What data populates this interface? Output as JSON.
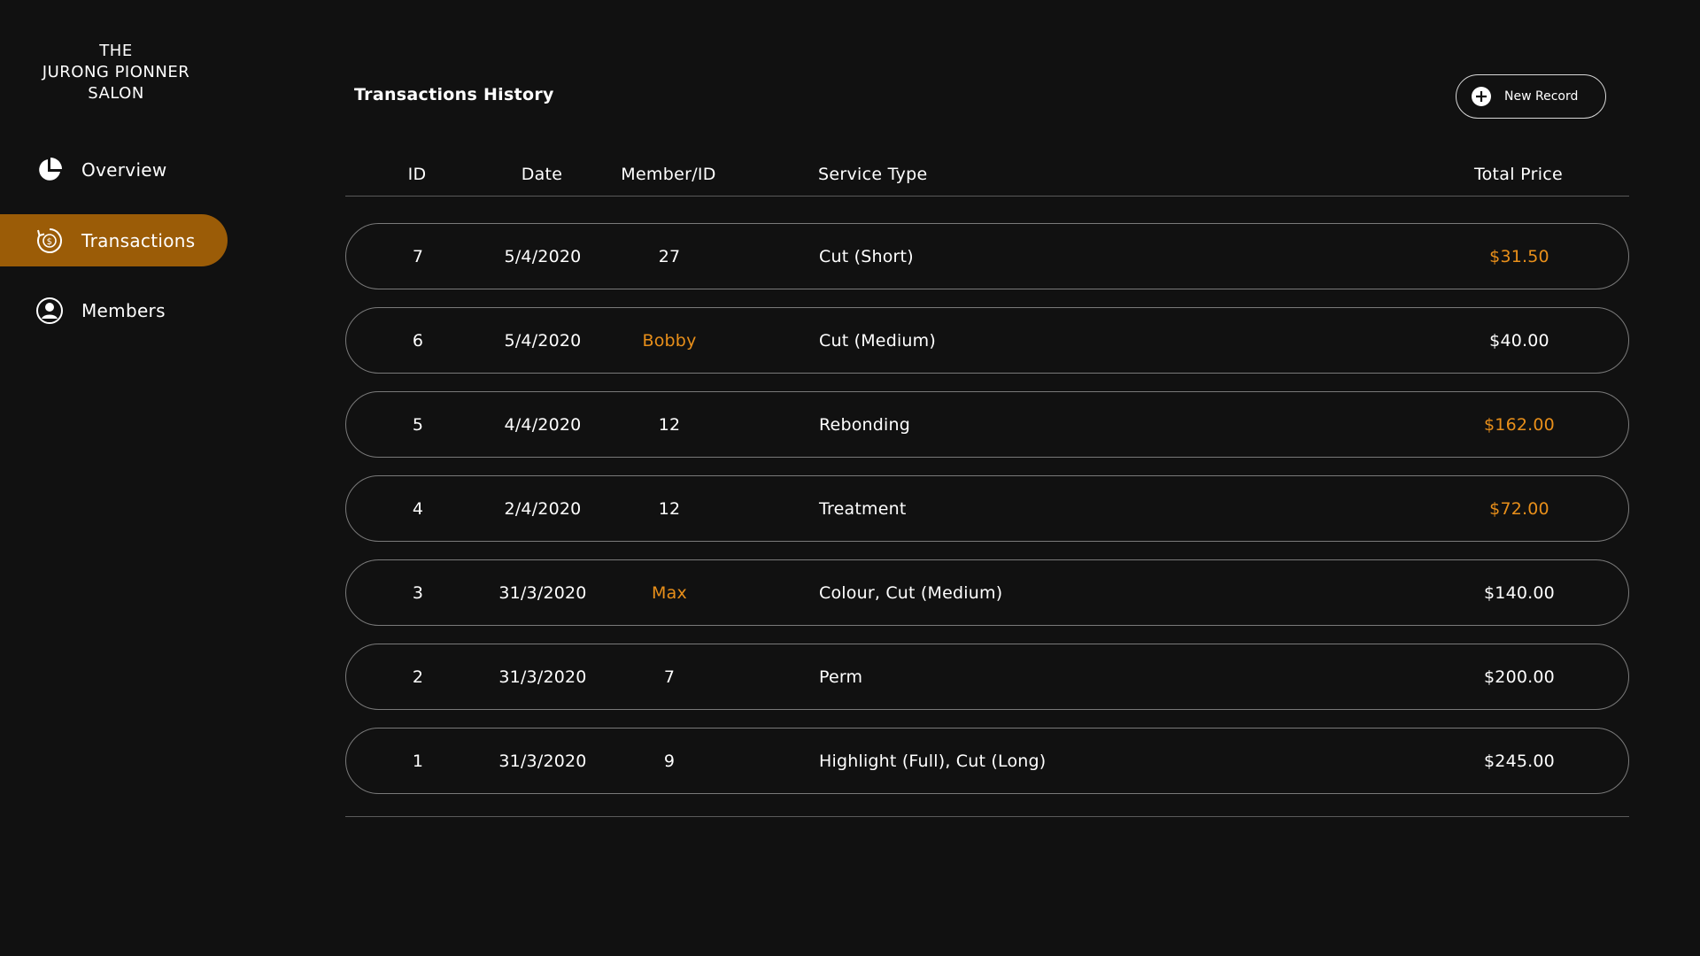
{
  "brand": {
    "line1": "THE",
    "line2": "JURONG PIONNER",
    "line3": "SALON"
  },
  "sidebar": {
    "items": [
      {
        "label": "Overview",
        "icon": "pie-chart-icon",
        "active": false
      },
      {
        "label": "Transactions",
        "icon": "dollar-cycle-icon",
        "active": true
      },
      {
        "label": "Members",
        "icon": "user-circle-icon",
        "active": false
      }
    ]
  },
  "main": {
    "title": "Transactions History",
    "new_record_label": "New Record",
    "columns": {
      "id": "ID",
      "date": "Date",
      "member": "Member/ID",
      "service": "Service Type",
      "price": "Total Price"
    },
    "rows": [
      {
        "id": "7",
        "date": "5/4/2020",
        "member": "27",
        "service": "Cut (Short)",
        "price": "$31.50"
      },
      {
        "id": "6",
        "date": "5/4/2020",
        "member": "Bobby",
        "service": "Cut (Medium)",
        "price": "$40.00"
      },
      {
        "id": "5",
        "date": "4/4/2020",
        "member": "12",
        "service": "Rebonding",
        "price": "$162.00"
      },
      {
        "id": "4",
        "date": "2/4/2020",
        "member": "12",
        "service": "Treatment",
        "price": "$72.00"
      },
      {
        "id": "3",
        "date": "31/3/2020",
        "member": "Max",
        "service": "Colour, Cut (Medium)",
        "price": "$140.00"
      },
      {
        "id": "2",
        "date": "31/3/2020",
        "member": "7",
        "service": "Perm",
        "price": "$200.00"
      },
      {
        "id": "1",
        "date": "31/3/2020",
        "member": "9",
        "service": "Highlight (Full), Cut (Long)",
        "price": "$245.00"
      }
    ]
  },
  "colors": {
    "background": "#111111",
    "accent": "#e88f1a",
    "active_nav": "#9b5c07",
    "text": "#ffffff"
  }
}
